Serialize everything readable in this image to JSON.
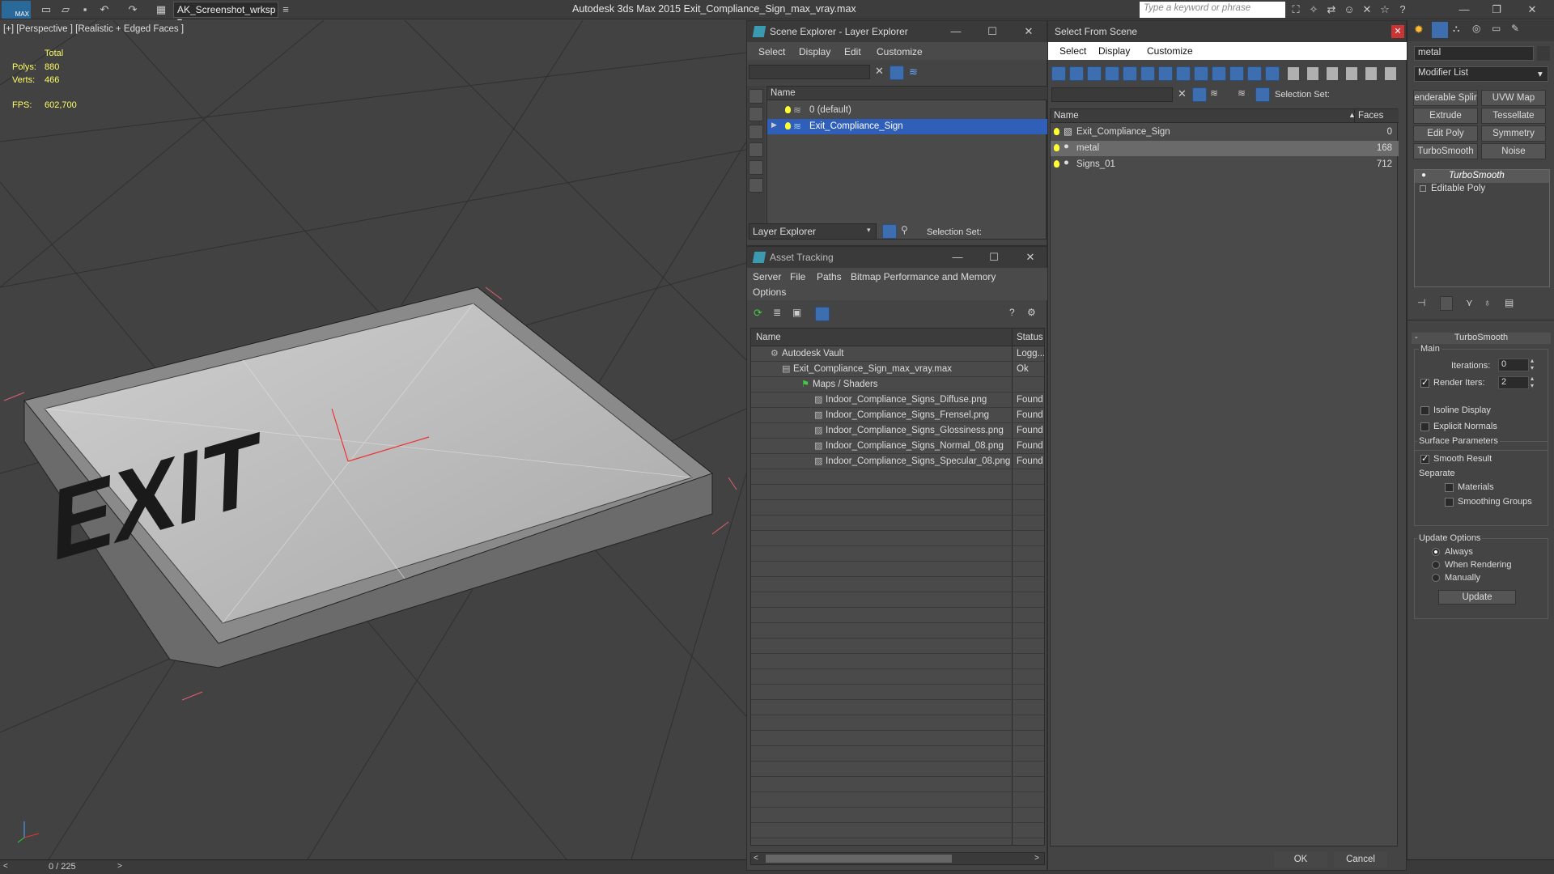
{
  "titlebar": {
    "app_logo": "MAX",
    "workspace": "AK_Screenshot_wrksp",
    "title": "Autodesk 3ds Max  2015    Exit_Compliance_Sign_max_vray.max",
    "search_placeholder": "Type a keyword or phrase"
  },
  "viewport": {
    "label": "[+] [Perspective ] [Realistic + Edged Faces ]",
    "stats_header": "Total",
    "polys_label": "Polys:",
    "polys_value": "880",
    "verts_label": "Verts:",
    "verts_value": "466",
    "fps_label": "FPS:",
    "fps_value": "602,700",
    "sign_text": "EXIT"
  },
  "status": {
    "frame_counter": "0 / 225"
  },
  "scene_explorer": {
    "title": "Scene Explorer - Layer Explorer",
    "menus": [
      "Select",
      "Display",
      "Edit",
      "Customize"
    ],
    "column_name": "Name",
    "rows": [
      "0 (default)",
      "Exit_Compliance_Sign"
    ],
    "footer_dropdown": "Layer Explorer",
    "selection_set_label": "Selection Set:"
  },
  "asset_tracking": {
    "title": "Asset Tracking",
    "menus": [
      "Server",
      "File",
      "Paths",
      "Bitmap Performance and Memory",
      "Options"
    ],
    "columns": [
      "Name",
      "Status"
    ],
    "rows": [
      {
        "name": "Autodesk Vault",
        "status": "Logg..."
      },
      {
        "name": "Exit_Compliance_Sign_max_vray.max",
        "status": "Ok"
      },
      {
        "name": "Maps / Shaders",
        "status": ""
      },
      {
        "name": "Indoor_Compliance_Signs_Diffuse.png",
        "status": "Found"
      },
      {
        "name": "Indoor_Compliance_Signs_Frensel.png",
        "status": "Found"
      },
      {
        "name": "Indoor_Compliance_Signs_Glossiness.png",
        "status": "Found"
      },
      {
        "name": "Indoor_Compliance_Signs_Normal_08.png",
        "status": "Found"
      },
      {
        "name": "Indoor_Compliance_Signs_Specular_08.png",
        "status": "Found"
      }
    ]
  },
  "select_from_scene": {
    "title": "Select From Scene",
    "menus": [
      "Select",
      "Display",
      "Customize"
    ],
    "selection_set_label": "Selection Set:",
    "columns": [
      "Name",
      "Faces"
    ],
    "rows": [
      {
        "name": "Exit_Compliance_Sign",
        "faces": "0"
      },
      {
        "name": "metal",
        "faces": "168"
      },
      {
        "name": "Signs_01",
        "faces": "712"
      }
    ],
    "ok": "OK",
    "cancel": "Cancel"
  },
  "command_panel": {
    "object_name": "metal",
    "modifier_list": "Modifier List",
    "modifier_buttons": [
      "enderable Splir",
      "UVW Map",
      "Extrude",
      "Tessellate",
      "Edit Poly",
      "Symmetry",
      "TurboSmooth",
      "Noise"
    ],
    "stack": [
      "TurboSmooth",
      "Editable Poly"
    ],
    "rollout_title": "TurboSmooth",
    "main_group": "Main",
    "iterations_label": "Iterations:",
    "iterations_value": "0",
    "render_iters_label": "Render Iters:",
    "render_iters_value": "2",
    "isoline_label": "Isoline Display",
    "explicit_normals_label": "Explicit Normals",
    "surface_group": "Surface Parameters",
    "smooth_result_label": "Smooth Result",
    "separate_label": "Separate",
    "materials_label": "Materials",
    "smoothing_groups_label": "Smoothing Groups",
    "update_group": "Update Options",
    "always_label": "Always",
    "when_rendering_label": "When Rendering",
    "manually_label": "Manually",
    "update_button": "Update"
  },
  "colors": {
    "selection": "#2f5fb8",
    "viewport_bg": "#424242",
    "stat_yellow": "#ffff66"
  }
}
